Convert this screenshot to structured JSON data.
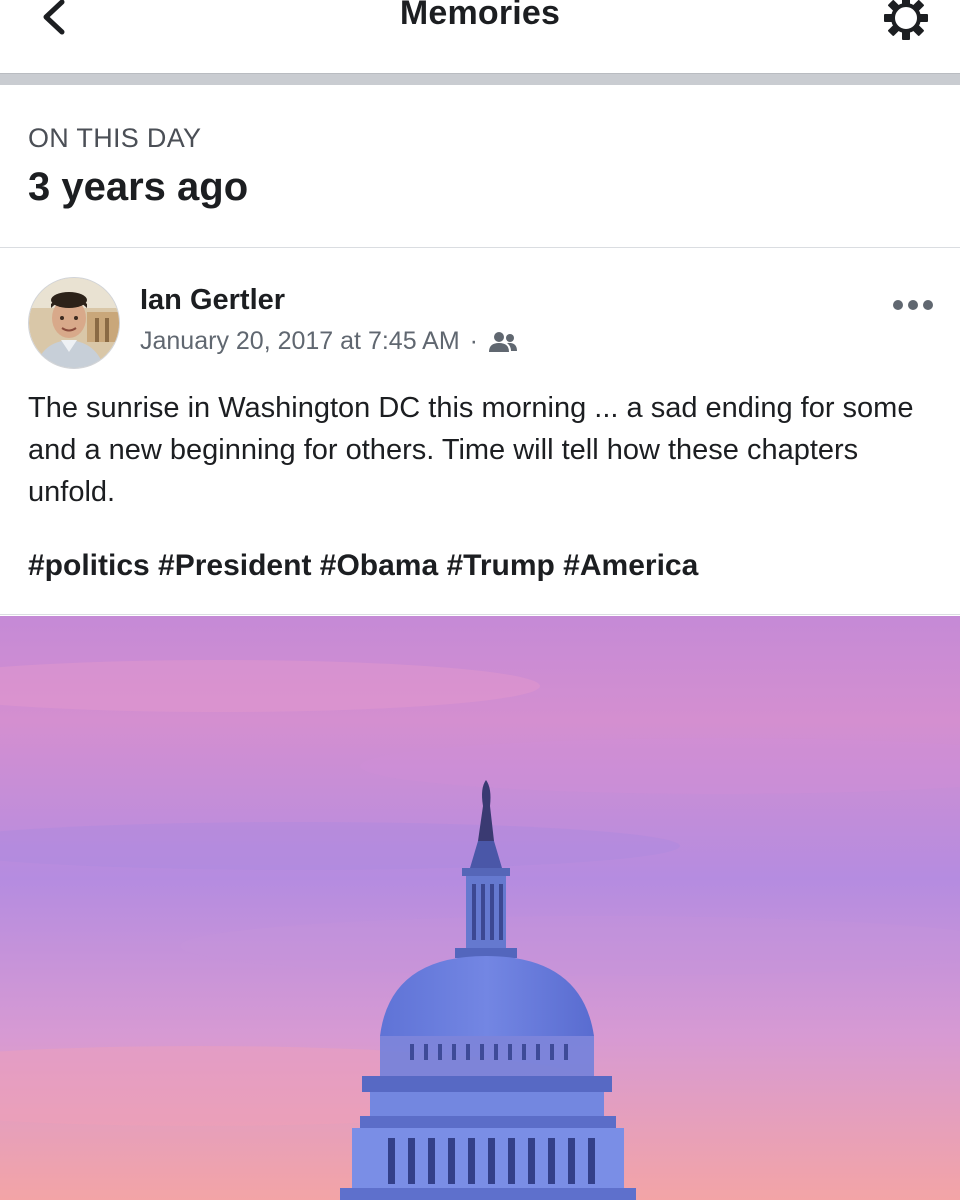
{
  "navbar": {
    "title": "Memories",
    "back_icon": "chevron-left-icon",
    "settings_icon": "gear-icon"
  },
  "on_this_day": {
    "label": "ON THIS DAY",
    "years_ago": "3 years ago"
  },
  "post": {
    "author": "Ian Gertler",
    "timestamp": "January 20, 2017 at 7:45 AM",
    "separator": "·",
    "audience_icon": "friends-icon",
    "more_icon": "more-horizontal-icon",
    "text": "The sunrise in Washington DC this morning ... a sad ending for some and a new beginning for others. Time will tell how these chapters unfold.",
    "hashtags": "#politics #President #Obama #Trump #America"
  },
  "colors": {
    "text_primary": "#1c1e21",
    "text_secondary": "#606770",
    "divider": "#c9ccd1",
    "sky_top": "#c58ad6",
    "sky_bottom": "#f3a4a6"
  }
}
